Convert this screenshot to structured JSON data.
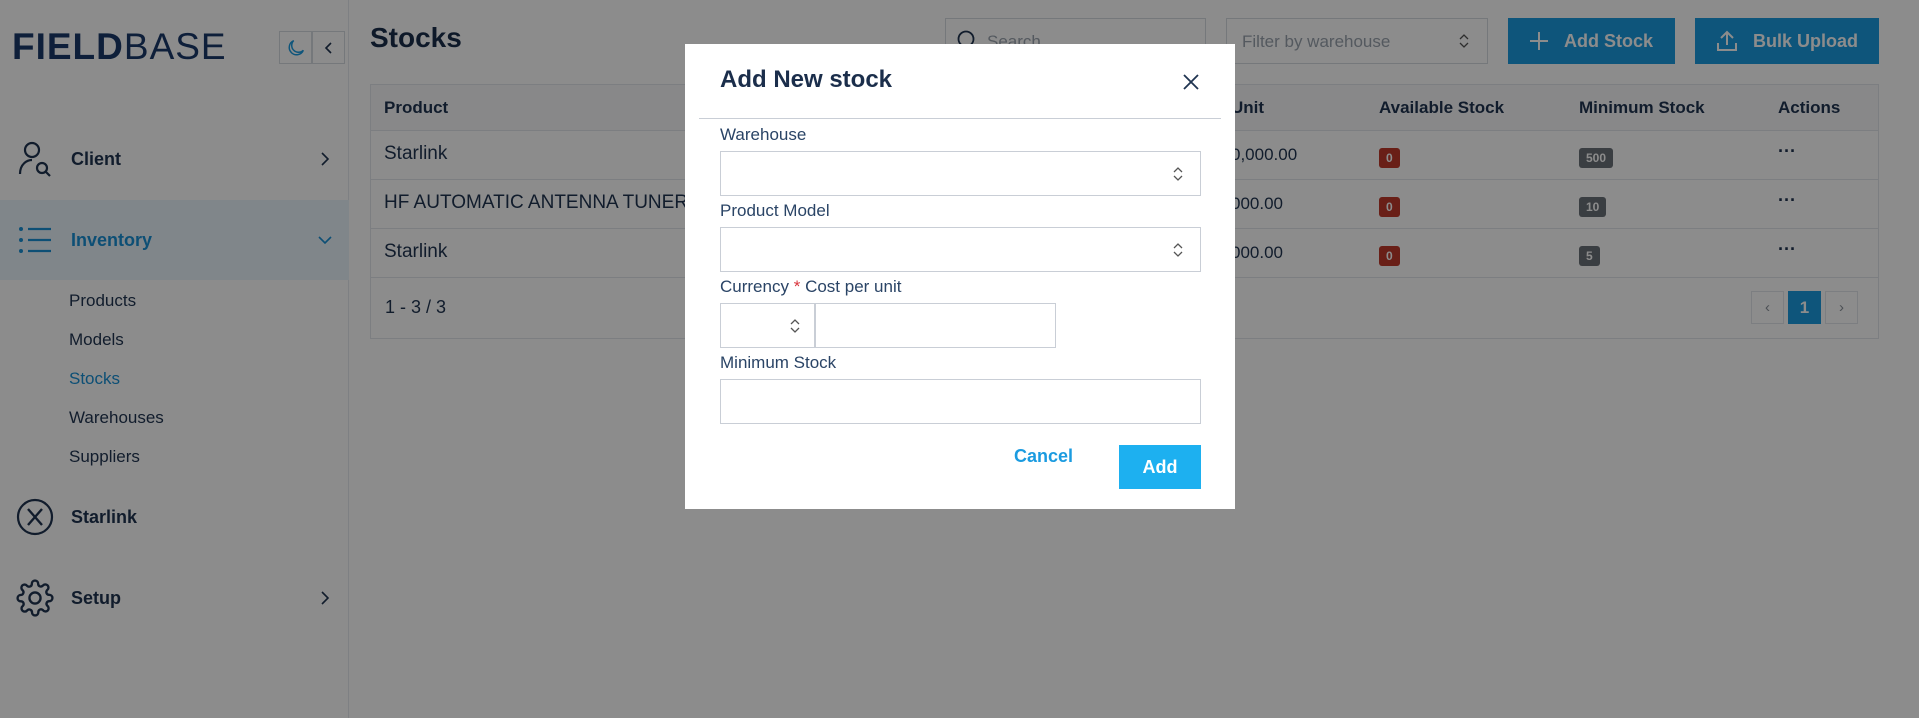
{
  "app": {
    "logo": {
      "part1": "FIELD",
      "part2": "BASE"
    }
  },
  "sidebar": {
    "items": [
      {
        "label": "Client",
        "icon": "user-search-icon"
      },
      {
        "label": "Inventory",
        "icon": "list-icon"
      },
      {
        "label": "Starlink",
        "icon": "starlink-icon"
      },
      {
        "label": "Setup",
        "icon": "gear-icon"
      }
    ],
    "subitems": [
      {
        "label": "Products"
      },
      {
        "label": "Models"
      },
      {
        "label": "Stocks"
      },
      {
        "label": "Warehouses"
      },
      {
        "label": "Suppliers"
      }
    ]
  },
  "header": {
    "title": "Stocks",
    "search_placeholder": "Search",
    "filter_placeholder": "Filter by warehouse",
    "add_stock_label": "Add Stock",
    "bulk_upload_label": "Bulk Upload"
  },
  "table": {
    "columns": [
      "Product",
      "Unit",
      "Available Stock",
      "Minimum Stock",
      "Actions"
    ],
    "rows": [
      {
        "product": "Starlink",
        "unit": "0,000.00",
        "available": "0",
        "minimum": "500",
        "actions": "···"
      },
      {
        "product": "HF AUTOMATIC ANTENNA TUNER",
        "unit": "000.00",
        "available": "0",
        "minimum": "10",
        "actions": "···"
      },
      {
        "product": "Starlink",
        "unit": "000.00",
        "available": "0",
        "minimum": "5",
        "actions": "···"
      }
    ],
    "count_text": "1 - 3 / 3",
    "pagination": {
      "prev": "‹",
      "current": "1",
      "next": "›"
    }
  },
  "modal": {
    "title": "Add New stock",
    "fields": {
      "warehouse_label": "Warehouse",
      "product_model_label": "Product Model",
      "currency_label": "Currency",
      "required_mark": "*",
      "cost_label": "Cost per unit",
      "minimum_stock_label": "Minimum Stock"
    },
    "cancel_label": "Cancel",
    "add_label": "Add"
  },
  "colors": {
    "accent": "#1b9be0",
    "danger_badge": "#c0392b",
    "muted_badge": "#6b7178",
    "overlay": "rgba(0,0,0,0.45)"
  }
}
